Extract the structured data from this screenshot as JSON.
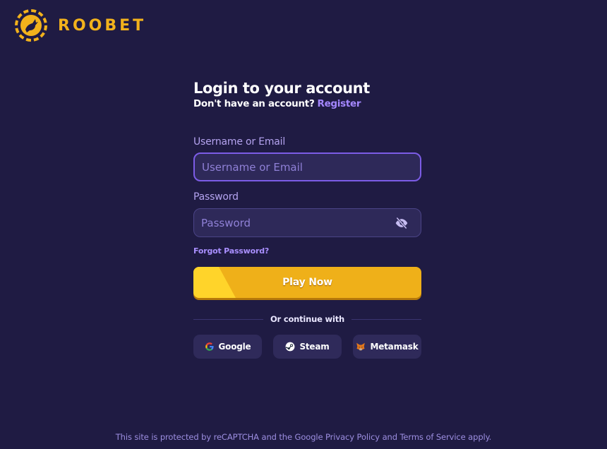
{
  "brand": {
    "name": "ROOBET",
    "color": "#f2b21c",
    "logo_icon": "kangaroo-chip-icon"
  },
  "login": {
    "title": "Login to your account",
    "no_account_text": "Don't have an account?",
    "register_link": "Register",
    "username_label": "Username or Email",
    "username_placeholder": "Username or Email",
    "username_value": "",
    "password_label": "Password",
    "password_placeholder": "Password",
    "password_value": "",
    "password_toggle_icon": "eye-off-icon",
    "forgot_link": "Forgot Password?",
    "submit_label": "Play Now",
    "divider_text": "Or continue with"
  },
  "social": [
    {
      "label": "Google",
      "icon": "google-icon"
    },
    {
      "label": "Steam",
      "icon": "steam-icon"
    },
    {
      "label": "Metamask",
      "icon": "metamask-icon"
    }
  ],
  "footer": {
    "text": "This site is protected by reCAPTCHA and the Google Privacy Policy and Terms of Service apply."
  },
  "colors": {
    "background": "#1f1b43",
    "accent_purple": "#7c5ce6",
    "button_yellow": "#efb019"
  }
}
